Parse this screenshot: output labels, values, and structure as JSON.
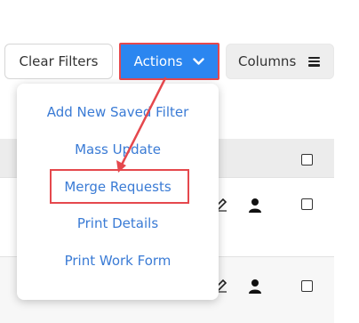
{
  "toolbar": {
    "clear_filters_label": "Clear Filters",
    "actions_label": "Actions",
    "columns_label": "Columns"
  },
  "actions_menu": {
    "items": [
      "Add New Saved Filter",
      "Mass Update",
      "Merge Requests",
      "Print Details",
      "Print Work Form"
    ],
    "highlighted_item": "Merge Requests"
  },
  "icons": {
    "actions_chevron": "chevron-down-icon",
    "columns": "hamburger-menu-icon",
    "row_edit": "edit-icon",
    "row_person": "person-icon"
  },
  "colors": {
    "accent_blue": "#2b86f0",
    "menu_text": "#3a7bd5",
    "annotation_red": "#e5484d",
    "header_row_bg": "#ececec"
  }
}
